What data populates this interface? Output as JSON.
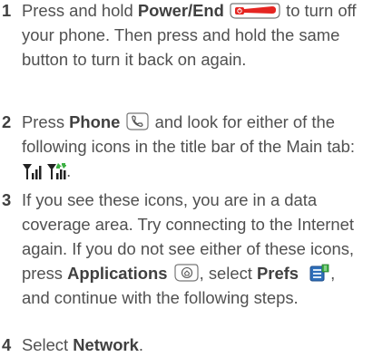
{
  "steps": [
    {
      "number": "1",
      "t1": "Press and hold",
      "b1": "Power/End",
      "t2": "to turn off your phone. Then press and hold the same button to turn it back on again.",
      "icon1": "power-end-button-icon"
    },
    {
      "number": "2",
      "t1": "Press",
      "b1": "Phone",
      "t2": "and look for either of the following icons in the title bar of the Main tab:",
      "t3": ".",
      "icon1": "phone-button-icon",
      "icon2": "signal-strength-icon",
      "icon3": "data-signal-icon"
    },
    {
      "number": "3",
      "t1": "If you see these icons, you are in a data coverage area. Try connecting to the Internet again. If you do not see either of these icons, press",
      "b1": "Applications",
      "t2": ",",
      "t3": "select",
      "b2": "Prefs",
      "t4": ", and continue with the following steps.",
      "icon1": "applications-button-icon",
      "icon2": "prefs-icon"
    },
    {
      "number": "4",
      "t1": "Select",
      "b1": "Network",
      "t2": "."
    }
  ],
  "colors": {
    "text": "#505050",
    "power_icon_red": "#e52521"
  }
}
